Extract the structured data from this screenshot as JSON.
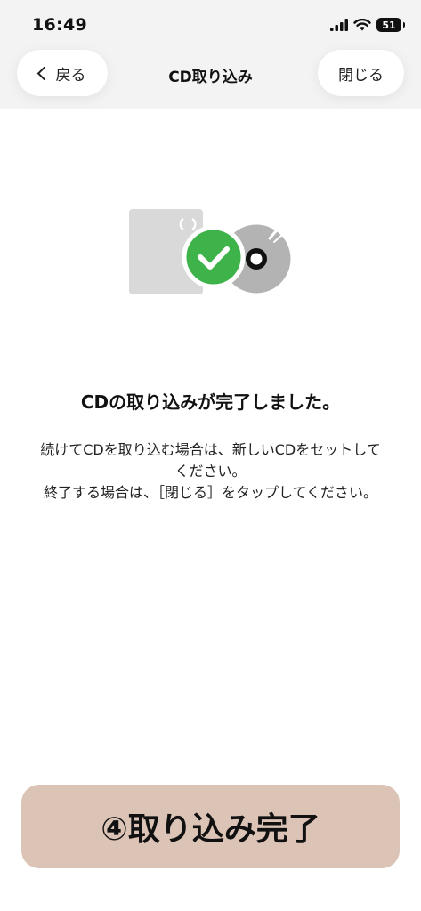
{
  "status_bar": {
    "time": "16:49",
    "battery_level": "51"
  },
  "nav": {
    "back_label": "戻る",
    "title": "CD取り込み",
    "close_label": "閉じる"
  },
  "main": {
    "heading": "CDの取り込みが完了しました。",
    "instruction_1": "続けてCDを取り込む場合は、新しいCDをセットしてください。",
    "instruction_2": "終了する場合は、［閉じる］をタップしてください。"
  },
  "banner": {
    "text": "④取り込み完了"
  },
  "colors": {
    "check_green": "#3db349",
    "banner_bg": "#dbc3b6",
    "disc_gray": "#b3b3b3",
    "case_gray": "#d9d9d9"
  },
  "icons": [
    "signal-icon",
    "wifi-icon",
    "battery-icon",
    "back-chevron-icon",
    "cd-case-icon",
    "check-icon",
    "cd-disc-icon"
  ]
}
